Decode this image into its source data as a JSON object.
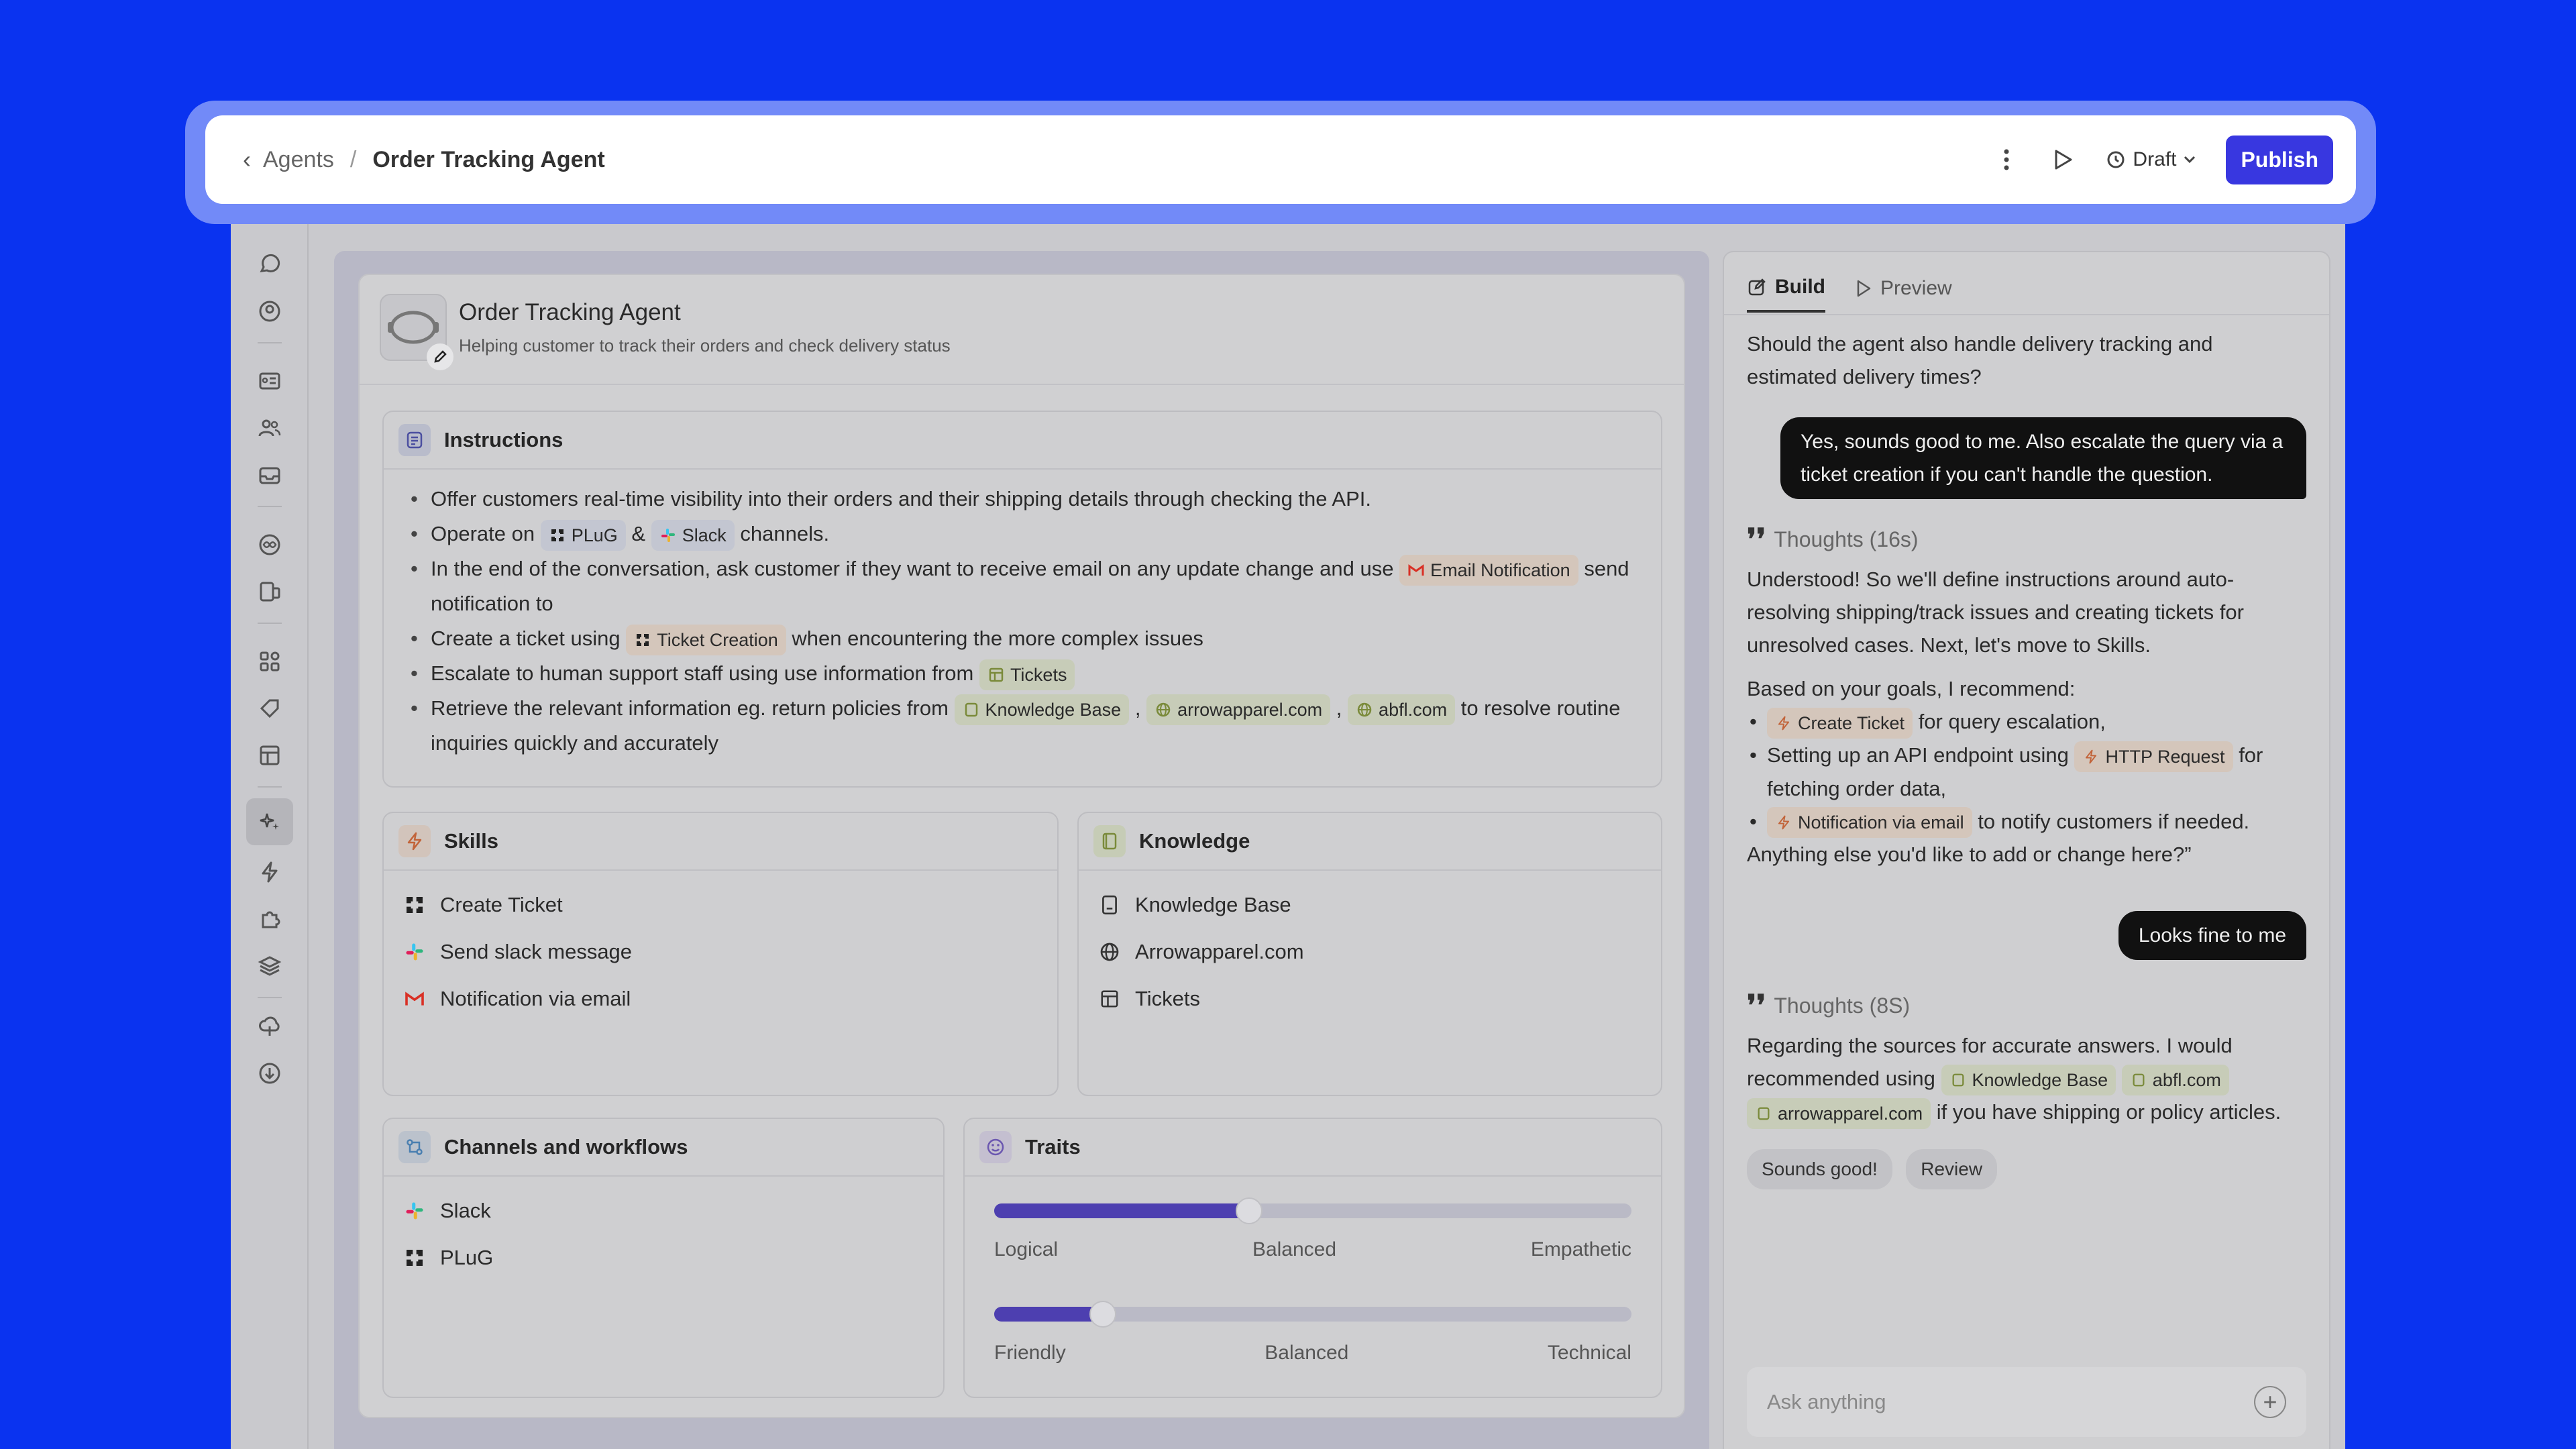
{
  "topbar": {
    "back_label": "‹",
    "crumb_parent": "Agents",
    "crumb_sep": "/",
    "crumb_current": "Order Tracking Agent",
    "draft_label": "Draft",
    "publish_label": "Publish"
  },
  "agent": {
    "name": "Order Tracking Agent",
    "description": "Helping customer to track their orders and check delivery status"
  },
  "instructions": {
    "title": "Instructions",
    "l1": "Offer customers real-time visibility into their orders and their shipping details through checking the API.",
    "l2_a": "Operate on",
    "l2_chip1": "PLuG",
    "l2_b": "&",
    "l2_chip2": "Slack",
    "l2_c": "channels.",
    "l3_a": "In the end of the conversation, ask customer if they want to receive email on any update change and use",
    "l3_chip": "Email Notification",
    "l3_b": "send notification to",
    "l4_a": "Create a ticket using",
    "l4_chip": "Ticket Creation",
    "l4_b": "when encountering the more complex issues",
    "l5_a": "Escalate to human support staff using use information from",
    "l5_chip": "Tickets",
    "l6_a": "Retrieve the relevant information eg. return policies from",
    "l6_chip1": "Knowledge Base",
    "l6_comma": ",",
    "l6_chip2": "arrowapparel.com",
    "l6_chip3": "abfl.com",
    "l6_b": "to resolve routine inquiries quickly and accurately"
  },
  "skills": {
    "title": "Skills",
    "items": [
      "Create Ticket",
      "Send slack message",
      "Notification via email"
    ]
  },
  "knowledge": {
    "title": "Knowledge",
    "items": [
      "Knowledge Base",
      "Arrowapparel.com",
      "Tickets"
    ]
  },
  "channels": {
    "title": "Channels and workflows",
    "items": [
      "Slack",
      "PLuG"
    ]
  },
  "traits": {
    "title": "Traits",
    "slider1": {
      "value": 0.4,
      "labels": [
        "Logical",
        "Balanced",
        "Empathetic"
      ]
    },
    "slider2": {
      "value": 0.17,
      "labels": [
        "Friendly",
        "Balanced",
        "Technical"
      ]
    }
  },
  "chat": {
    "tab_build": "Build",
    "tab_preview": "Preview",
    "q1": "Should the agent also handle delivery tracking and estimated delivery times?",
    "user1": "Yes, sounds good to me. Also escalate the query via a ticket creation if you can't handle the question.",
    "thoughts1": "Thoughts (16s)",
    "reply1": "Understood! So we'll define instructions around auto-resolving shipping/track issues and creating tickets for unresolved cases. Next, let's move to Skills.",
    "rec_intro": "Based on your goals, I recommend:",
    "rec1_chip": "Create Ticket",
    "rec1_text": "for query escalation,",
    "rec2_a": "Setting up an API endpoint using",
    "rec2_chip": "HTTP Request",
    "rec2_b": "for fetching order data,",
    "rec3_chip": "Notification via email",
    "rec3_text": "to notify customers if needed.",
    "rec_outro": "Anything else you'd like to add or change here?”",
    "user2": "Looks fine to me",
    "thoughts2": "Thoughts (8S)",
    "reply2_a": "Regarding the sources for accurate answers. I would recommended using",
    "reply2_chip1": "Knowledge Base",
    "reply2_chip2": "abfl.com",
    "reply2_chip3": "arrowapparel.com",
    "reply2_b": "if you have shipping or policy articles.",
    "pill1": "Sounds good!",
    "pill2": "Review",
    "ask_placeholder": "Ask anything",
    "ask_plus": "+"
  },
  "colors": {
    "background": "#0a33f0",
    "publish": "#3837e0",
    "slider_fill": "#4d3fb0"
  },
  "icons": [
    "chevron-left-icon",
    "more-vertical-icon",
    "play-icon",
    "history-icon",
    "chevron-down-icon",
    "pencil-icon",
    "document-icon",
    "lightning-icon",
    "book-icon",
    "workflow-icon",
    "smile-icon",
    "globe-icon",
    "table-icon",
    "gmail-icon",
    "slack-icon",
    "plug-icon",
    "edit-icon",
    "plus-icon"
  ]
}
